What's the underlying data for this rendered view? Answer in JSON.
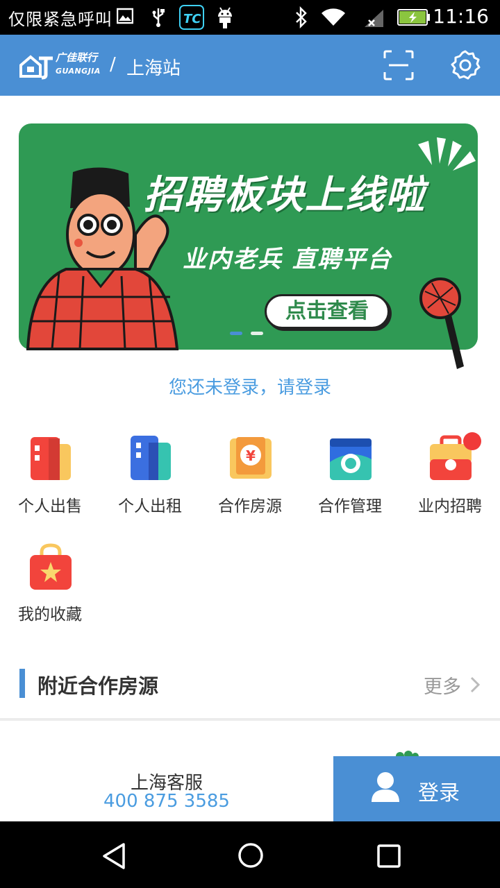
{
  "status_bar": {
    "carrier": "仅限紧急呼叫",
    "time": "11:16",
    "icons": [
      "image-icon",
      "usb-icon",
      "tc-app-icon",
      "android-icon",
      "bluetooth-icon",
      "wifi-icon",
      "signal-icon",
      "battery-charging-icon"
    ]
  },
  "header": {
    "logo_cn": "广佳联行",
    "logo_en": "GUANGJIA",
    "separator": "/",
    "station": "上海站",
    "icons": [
      "scan-icon",
      "settings-icon"
    ]
  },
  "banner": {
    "headline": "招聘板块上线啦",
    "subtitle": "业内老兵 直聘平台",
    "cta": "点击查看",
    "active_dot": 0,
    "dot_count": 2,
    "background": "#2f9a54"
  },
  "login_hint": "您还未登录，请登录",
  "grid": [
    {
      "label": "个人出售",
      "icon": "sale-building-icon"
    },
    {
      "label": "个人出租",
      "icon": "rent-building-icon"
    },
    {
      "label": "合作房源",
      "icon": "yuan-document-icon"
    },
    {
      "label": "合作管理",
      "icon": "camera-manage-icon"
    },
    {
      "label": "业内招聘",
      "icon": "briefcase-icon",
      "badge": true
    },
    {
      "label": "我的收藏",
      "icon": "star-bag-icon"
    }
  ],
  "section": {
    "title": "附近合作房源",
    "more": "更多"
  },
  "bottom": {
    "service_name": "上海客服",
    "service_phone": "400 875 3585",
    "login": "登录"
  },
  "colors": {
    "accent": "#4a8fd4",
    "link": "#4a9ce0",
    "badge": "#f03a3a"
  }
}
